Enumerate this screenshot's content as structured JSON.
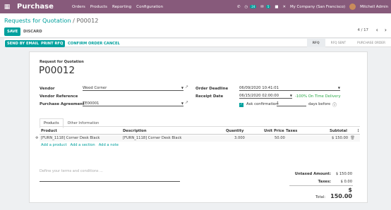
{
  "topbar": {
    "brand": "Purchase",
    "menu": [
      "Orders",
      "Products",
      "Reporting",
      "Configuration"
    ],
    "activity_count": "24",
    "message_count": "5",
    "company": "My Company (San Francisco)",
    "user": "Mitchell Admin",
    "icons": [
      "phone-icon",
      "activity-icon",
      "chat-icon",
      "gift-icon",
      "close-icon"
    ]
  },
  "control_panel": {
    "breadcrumb_root": "Requests for Quotation",
    "breadcrumb_sep": "/",
    "breadcrumb_current": "P00012",
    "save_label": "SAVE",
    "discard_label": "DISCARD",
    "pager": "4 / 17"
  },
  "statusbar": {
    "send_email": "SEND BY EMAIL",
    "print_rfq": "PRINT RFQ",
    "confirm": "CONFIRM ORDER",
    "cancel": "CANCEL",
    "stages": [
      "RFQ",
      "RFQ SENT",
      "PURCHASE ORDER"
    ],
    "active_stage": "RFQ"
  },
  "form": {
    "title_label": "Request for Quotation",
    "name": "P00012",
    "vendor_label": "Vendor",
    "vendor_value": "Wood Corner",
    "vendor_ref_label": "Vendor Reference",
    "agreement_label": "Purchase Agreement",
    "agreement_value": "TE00001",
    "deadline_label": "Order Deadline",
    "deadline_value": "06/09/2020 10:41:01",
    "receipt_label": "Receipt Date",
    "receipt_value": "06/15/2020 02:00:00",
    "on_time": "-100% On Time Delivery",
    "ask_confirmation": "Ask confirmation",
    "ask_days": "1",
    "days_before": "days before"
  },
  "tabs": [
    "Products",
    "Other Information"
  ],
  "table": {
    "headers": [
      "Product",
      "Description",
      "Quantity",
      "Unit Price",
      "Taxes",
      "Subtotal"
    ],
    "rows": [
      {
        "product": "[FURN_1118] Corner Desk Black",
        "description": "[FURN_1118] Corner Desk Black",
        "quantity": "3.000",
        "unit_price": "50.00",
        "taxes": "",
        "subtotal": "$ 150.00"
      }
    ],
    "add_product": "Add a product",
    "add_section": "Add a section",
    "add_note": "Add a note"
  },
  "terms_placeholder": "Define your terms and conditions ...",
  "totals": {
    "untaxed_label": "Untaxed Amount:",
    "untaxed_value": "$ 150.00",
    "taxes_label": "Taxes:",
    "taxes_value": "$ 0.00",
    "total_label": "Total:",
    "total_value": "$ 150.00"
  },
  "colors": {
    "topbar": "#875a7b",
    "accent": "#00a09d",
    "positive": "#28a745"
  }
}
